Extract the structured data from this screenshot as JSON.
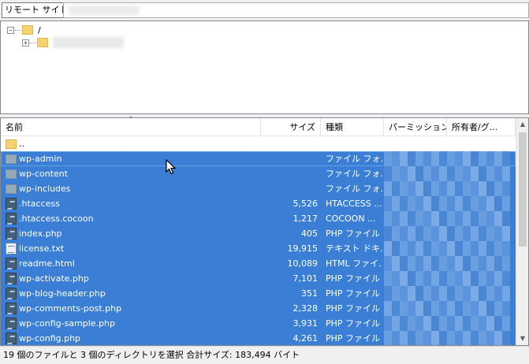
{
  "site_bar": {
    "label": "リモート サイト:",
    "path": ""
  },
  "tree": {
    "root": {
      "expander": "−",
      "label": "/"
    },
    "child": {
      "expander": "+"
    }
  },
  "columns": [
    "名前",
    "サイズ",
    "種類",
    "パーミッション",
    "所有者/グ..."
  ],
  "files": [
    {
      "name": "..",
      "size": "",
      "type": "",
      "icon": "folder-icon",
      "selected": false
    },
    {
      "name": "wp-admin",
      "size": "",
      "type": "ファイル フォ...",
      "icon": "folder-icon",
      "selected": true
    },
    {
      "name": "wp-content",
      "size": "",
      "type": "ファイル フォ...",
      "icon": "folder-icon",
      "selected": true
    },
    {
      "name": "wp-includes",
      "size": "",
      "type": "ファイル フォ...",
      "icon": "folder-icon",
      "selected": true
    },
    {
      "name": ".htaccess",
      "size": "5,526",
      "type": "HTACCESS ...",
      "icon": "script-file-icon",
      "selected": true
    },
    {
      "name": ".htaccess.cocoon",
      "size": "1,217",
      "type": "COCOON ...",
      "icon": "script-file-icon",
      "selected": true
    },
    {
      "name": "index.php",
      "size": "405",
      "type": "PHP ファイル",
      "icon": "script-file-icon",
      "selected": true
    },
    {
      "name": "license.txt",
      "size": "19,915",
      "type": "テキスト ドキ...",
      "icon": "text-file-icon",
      "selected": true
    },
    {
      "name": "readme.html",
      "size": "10,089",
      "type": "HTML ファイ...",
      "icon": "script-file-icon",
      "selected": true
    },
    {
      "name": "wp-activate.php",
      "size": "7,101",
      "type": "PHP ファイル",
      "icon": "script-file-icon",
      "selected": true
    },
    {
      "name": "wp-blog-header.php",
      "size": "351",
      "type": "PHP ファイル",
      "icon": "script-file-icon",
      "selected": true
    },
    {
      "name": "wp-comments-post.php",
      "size": "2,328",
      "type": "PHP ファイル",
      "icon": "script-file-icon",
      "selected": true
    },
    {
      "name": "wp-config-sample.php",
      "size": "3,931",
      "type": "PHP ファイル",
      "icon": "script-file-icon",
      "selected": true
    },
    {
      "name": "wp-config.php",
      "size": "4,261",
      "type": "PHP ファイル",
      "icon": "script-file-icon",
      "selected": true
    }
  ],
  "status": "19 個のファイルと 3 個のディレクトリを選択 合計サイズ: 183,494 バイト",
  "colors": {
    "selection": "#3a7fd5",
    "folder": "#f6d372"
  }
}
